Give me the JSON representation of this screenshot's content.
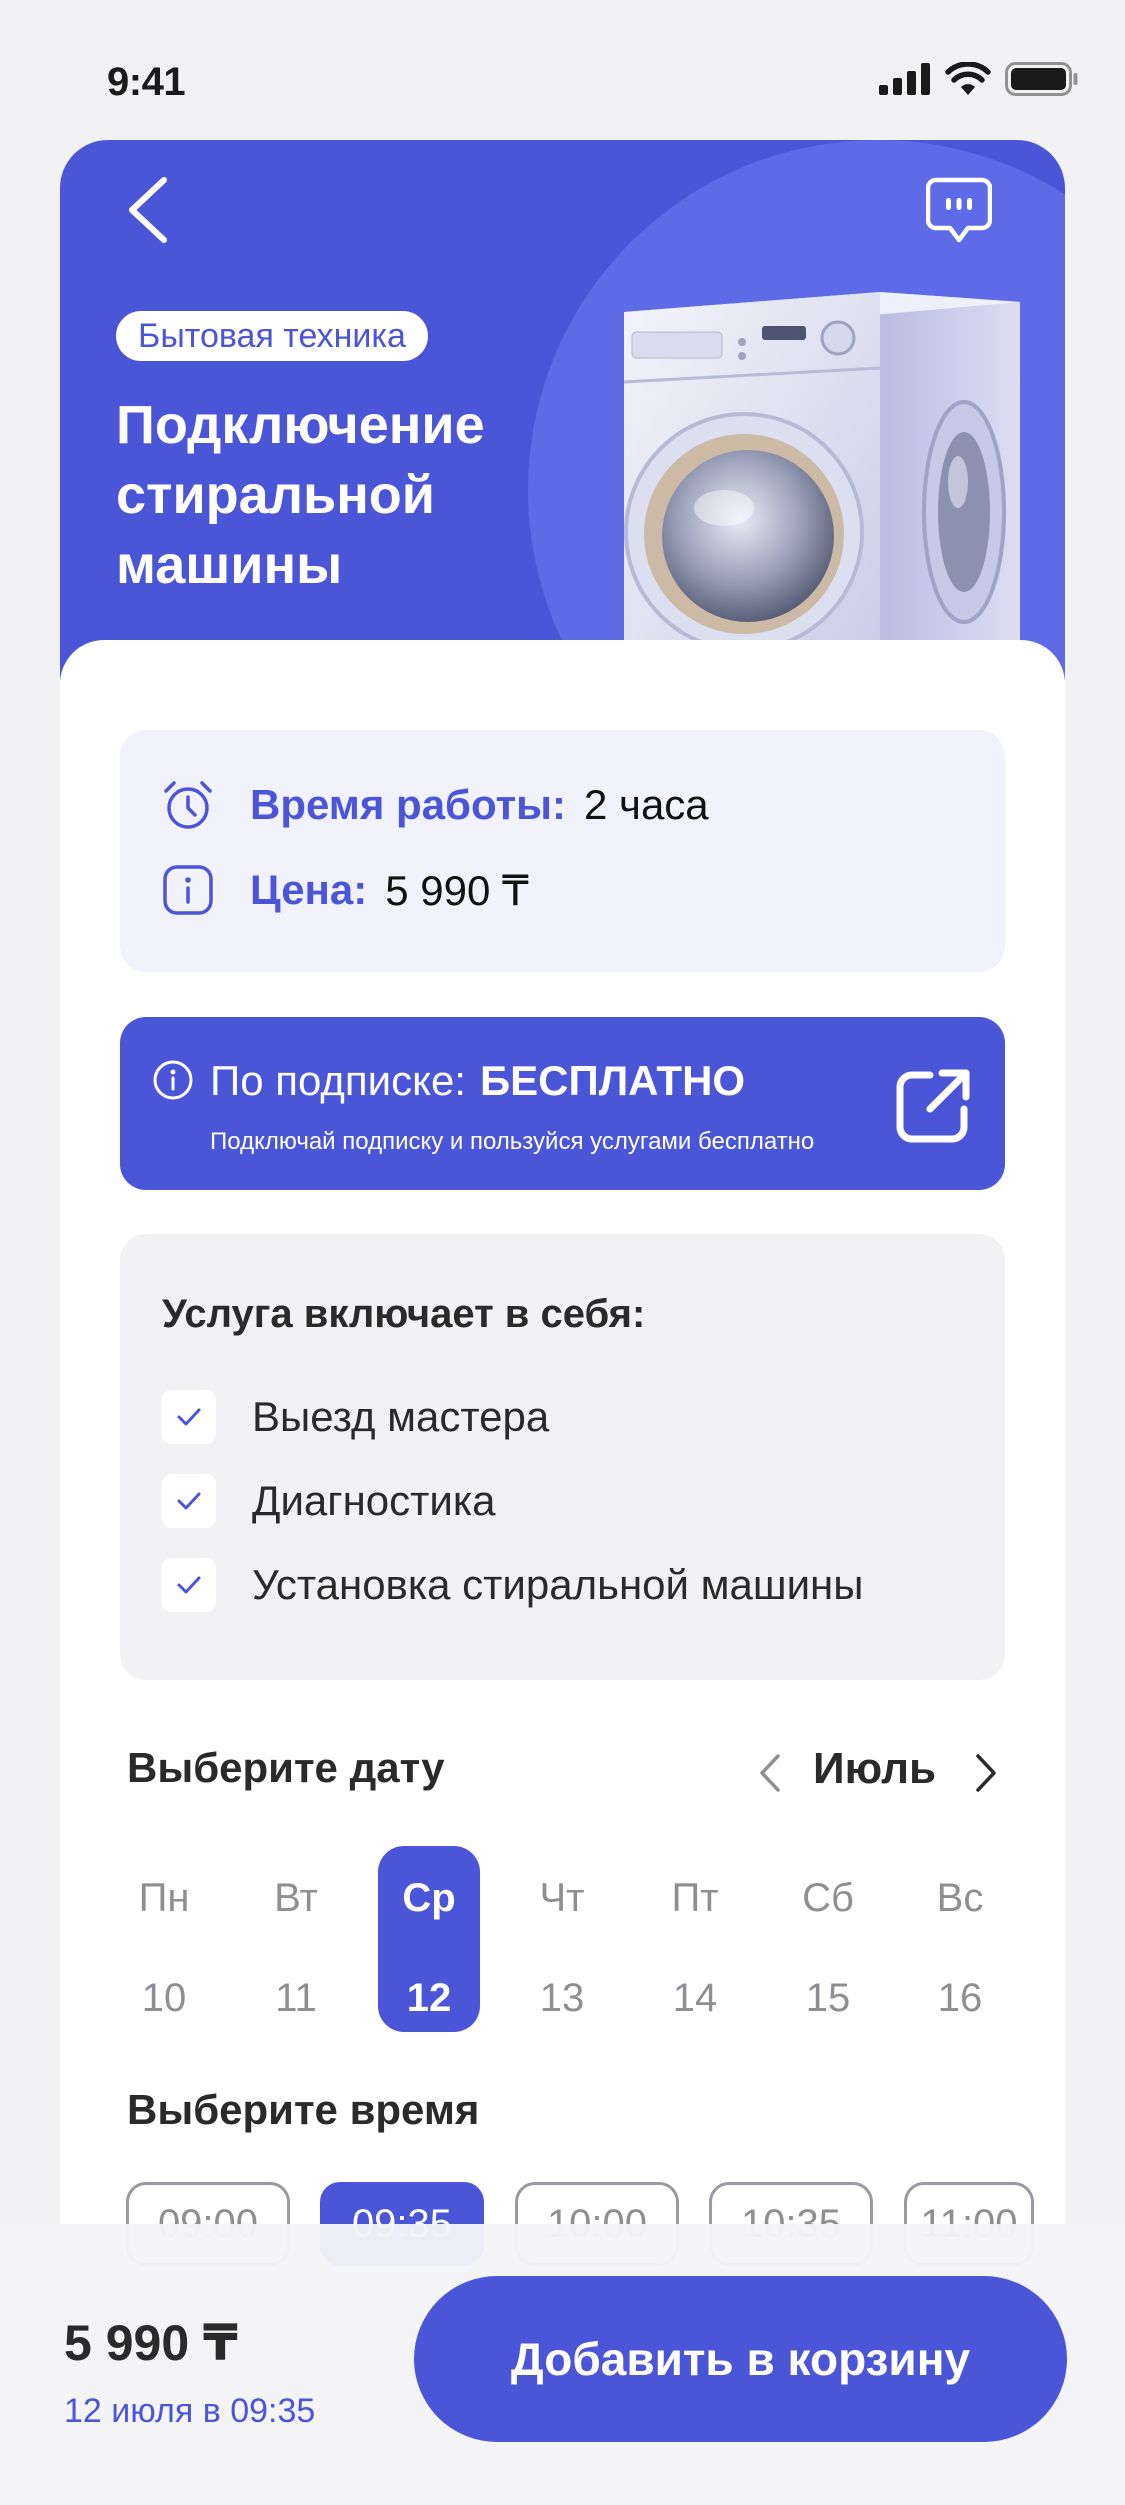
{
  "status_bar": {
    "time": "9:41"
  },
  "header": {
    "category": "Бытовая техника",
    "title_lines": [
      "Подключение",
      "стиральной",
      "машины"
    ],
    "back_icon": "chevron-left-icon",
    "chat_icon": "chat-bubble-icon"
  },
  "info": {
    "duration_label": "Время работы:",
    "duration_value": "2 часа",
    "price_label": "Цена:",
    "price_value": "5 990 ₸"
  },
  "subscription": {
    "label": "По подписке:",
    "value": "БЕСПЛАТНО",
    "description": "Подключай подписку и пользуйся услугами бесплатно"
  },
  "includes": {
    "title": "Услуга включает в себя:",
    "items": [
      "Выезд мастера",
      "Диагностика",
      "Установка стиральной машины"
    ]
  },
  "date_picker": {
    "title": "Выберите дату",
    "month": "Июль",
    "days": [
      {
        "name": "Пн",
        "num": "10"
      },
      {
        "name": "Вт",
        "num": "11"
      },
      {
        "name": "Ср",
        "num": "12"
      },
      {
        "name": "Чт",
        "num": "13"
      },
      {
        "name": "Пт",
        "num": "14"
      },
      {
        "name": "Сб",
        "num": "15"
      },
      {
        "name": "Вс",
        "num": "16"
      }
    ],
    "selected_index": 2
  },
  "time_picker": {
    "title": "Выберите время",
    "slots": [
      "09:00",
      "09:35",
      "10:00",
      "10:35",
      "11:00"
    ],
    "selected_index": 1
  },
  "footer": {
    "price": "5 990 ₸",
    "date_time": "12 июля в 09:35",
    "add_button": "Добавить в корзину"
  },
  "colors": {
    "accent": "#4b55d8",
    "accent_light": "#5f6be6",
    "info_bg": "#f2f2fd",
    "muted": "#8e8e93"
  }
}
